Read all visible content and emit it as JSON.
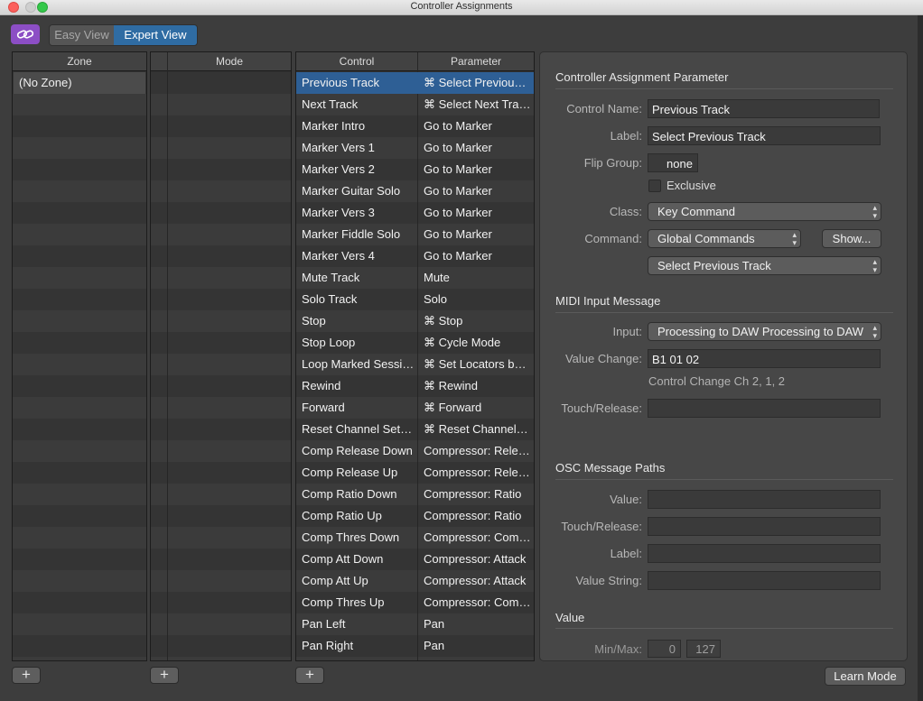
{
  "window": {
    "title": "Controller Assignments"
  },
  "toolbar": {
    "easy_view": "Easy View",
    "expert_view": "Expert View",
    "link_icon": "link-icon"
  },
  "zone": {
    "header": "Zone",
    "items": [
      "(No Zone)"
    ]
  },
  "mode": {
    "header": "Mode"
  },
  "controls": {
    "header_control": "Control",
    "header_parameter": "Parameter",
    "rows": [
      {
        "control": "Previous Track",
        "parameter": "⌘ Select Previou…"
      },
      {
        "control": "Next Track",
        "parameter": "⌘ Select Next Tra…"
      },
      {
        "control": "Marker Intro",
        "parameter": "Go to Marker"
      },
      {
        "control": "Marker Vers 1",
        "parameter": "Go to Marker"
      },
      {
        "control": "Marker Vers 2",
        "parameter": "Go to Marker"
      },
      {
        "control": "Marker Guitar Solo",
        "parameter": "Go to Marker"
      },
      {
        "control": "Marker Vers 3",
        "parameter": "Go to Marker"
      },
      {
        "control": "Marker Fiddle Solo",
        "parameter": "Go to Marker"
      },
      {
        "control": "Marker Vers 4",
        "parameter": "Go to Marker"
      },
      {
        "control": "Mute Track",
        "parameter": "Mute"
      },
      {
        "control": "Solo Track",
        "parameter": "Solo"
      },
      {
        "control": "Stop",
        "parameter": "⌘ Stop"
      },
      {
        "control": "Stop Loop",
        "parameter": "⌘ Cycle Mode"
      },
      {
        "control": "Loop Marked Sessi…",
        "parameter": "⌘ Set Locators b…"
      },
      {
        "control": "Rewind",
        "parameter": "⌘ Rewind"
      },
      {
        "control": "Forward",
        "parameter": "⌘ Forward"
      },
      {
        "control": "Reset Channel Set…",
        "parameter": "⌘ Reset Channel…"
      },
      {
        "control": "Comp Release Down",
        "parameter": "Compressor: Rele…"
      },
      {
        "control": "Comp Release Up",
        "parameter": "Compressor: Rele…"
      },
      {
        "control": "Comp Ratio Down",
        "parameter": "Compressor: Ratio"
      },
      {
        "control": "Comp Ratio Up",
        "parameter": "Compressor: Ratio"
      },
      {
        "control": "Comp Thres Down",
        "parameter": "Compressor: Com…"
      },
      {
        "control": "Comp Att Down",
        "parameter": "Compressor: Attack"
      },
      {
        "control": "Comp Att Up",
        "parameter": "Compressor: Attack"
      },
      {
        "control": "Comp Thres Up",
        "parameter": "Compressor: Com…"
      },
      {
        "control": "Pan Left",
        "parameter": "Pan"
      },
      {
        "control": "Pan Right",
        "parameter": "Pan"
      }
    ]
  },
  "buttons": {
    "add": "+",
    "learn_mode": "Learn Mode",
    "show": "Show..."
  },
  "inspector": {
    "assignment": {
      "title": "Controller Assignment Parameter",
      "control_name_label": "Control Name:",
      "control_name_value": "Previous Track",
      "label_label": "Label:",
      "label_value": "Select Previous Track",
      "flip_group_label": "Flip Group:",
      "flip_group_value": "none",
      "exclusive_label": "Exclusive",
      "class_label": "Class:",
      "class_value": "Key Command",
      "command_label": "Command:",
      "command_value": "Global Commands",
      "command_sub_value": "Select Previous Track"
    },
    "midi": {
      "title": "MIDI Input Message",
      "input_label": "Input:",
      "input_value": "Processing to DAW Processing to DAW",
      "value_change_label": "Value Change:",
      "value_change_value": "B1 01 02",
      "value_change_note": "Control Change Ch 2, 1, 2",
      "touch_release_label": "Touch/Release:"
    },
    "osc": {
      "title": "OSC Message Paths",
      "value_label": "Value:",
      "touch_release_label": "Touch/Release:",
      "label_label": "Label:",
      "value_string_label": "Value String:"
    },
    "value": {
      "title": "Value",
      "minmax_label": "Min/Max:",
      "min": "0",
      "max": "127"
    }
  }
}
